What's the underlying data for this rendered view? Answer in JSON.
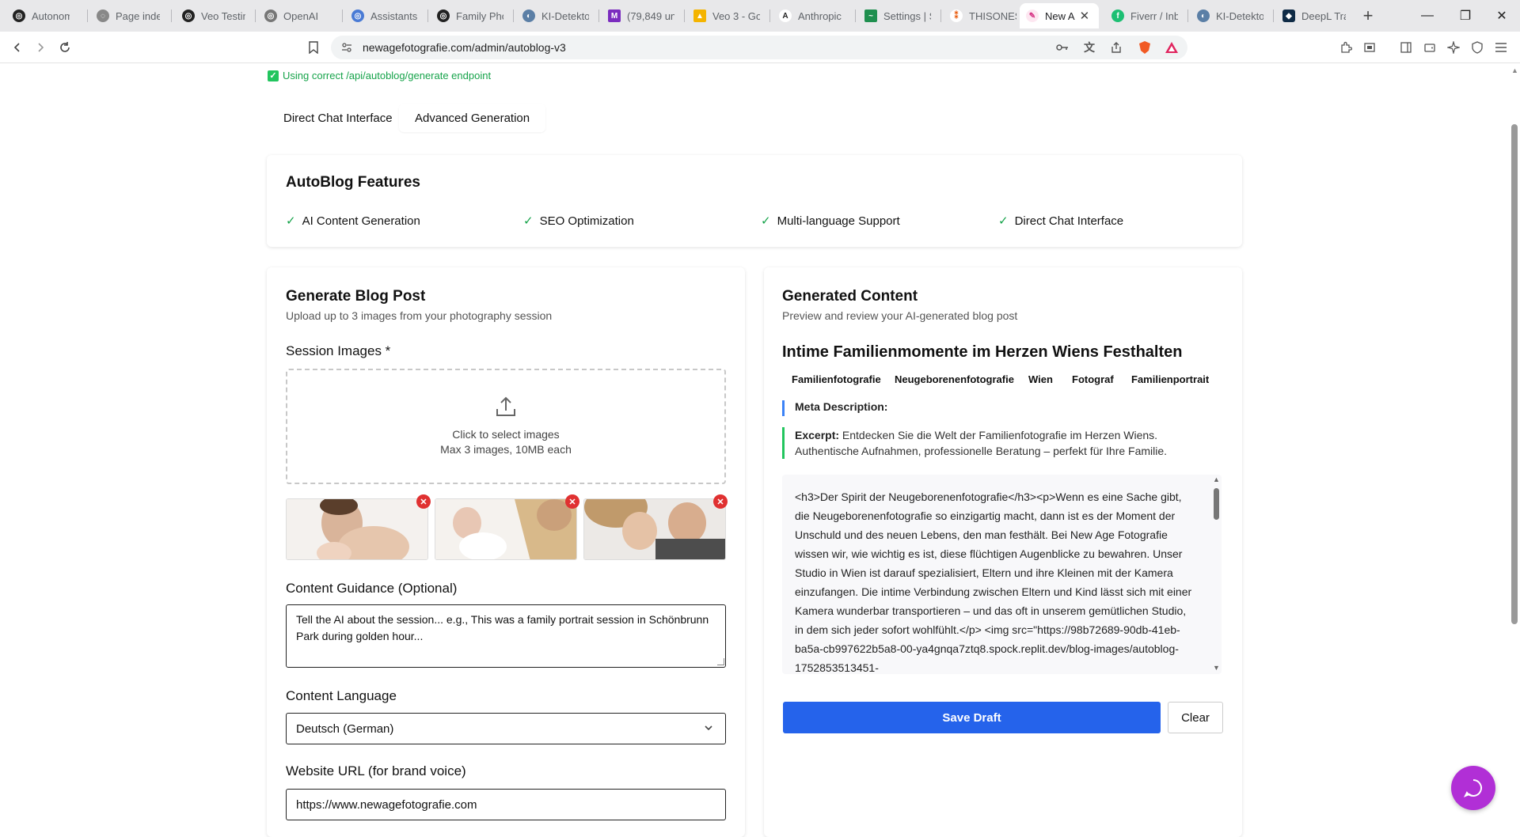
{
  "browser": {
    "tabs": [
      {
        "title": "Autonomo",
        "favicon": "openai-icon",
        "color": "#222222"
      },
      {
        "title": "Page index",
        "favicon": "page-index-icon",
        "color": "#666666"
      },
      {
        "title": "Veo Testim",
        "favicon": "openai-icon",
        "color": "#222222"
      },
      {
        "title": "OpenAI",
        "favicon": "openai-icon",
        "color": "#777777"
      },
      {
        "title": "Assistants",
        "favicon": "assistants-icon",
        "color": "#4a7bd5"
      },
      {
        "title": "Family Pho",
        "favicon": "openai-icon",
        "color": "#222222"
      },
      {
        "title": "KI-Detekto",
        "favicon": "ki-detektor-icon",
        "color": "#5b7fa6"
      },
      {
        "title": "(79,849 un",
        "favicon": "mail-icon",
        "color": "#7b2cbf"
      },
      {
        "title": "Veo 3 - Go",
        "favicon": "google-drive-icon",
        "color": "#f4b400"
      },
      {
        "title": "Anthropic",
        "favicon": "anthropic-icon",
        "color": "#222222"
      },
      {
        "title": "Settings | S",
        "favicon": "settings-app-icon",
        "color": "#1f8f4f"
      },
      {
        "title": "THISONES",
        "favicon": "thisones-icon",
        "color": "#e8590c"
      },
      {
        "title": "New A",
        "favicon": "new-tab-icon",
        "color": "#d63384",
        "active": true
      },
      {
        "title": "Fiverr / Inb",
        "favicon": "fiverr-icon",
        "color": "#1dbf73"
      },
      {
        "title": "KI-Detekto",
        "favicon": "ki-detektor-icon",
        "color": "#5b7fa6"
      },
      {
        "title": "DeepL Tra",
        "favicon": "deepl-icon",
        "color": "#0f2b46"
      }
    ],
    "url": "newagefotografie.com/admin/autoblog-v3"
  },
  "status": {
    "endpoint_text": "Using correct /api/autoblog/generate endpoint",
    "color": "#16a34a"
  },
  "tabs": {
    "direct_chat": "Direct Chat Interface",
    "advanced": "Advanced Generation"
  },
  "features": {
    "title": "AutoBlog Features",
    "items": [
      "AI Content Generation",
      "SEO Optimization",
      "Multi-language Support",
      "Direct Chat Interface"
    ]
  },
  "generate": {
    "title": "Generate Blog Post",
    "subtitle": "Upload up to 3 images from your photography session",
    "session_images_label": "Session Images *",
    "dropzone_primary": "Click to select images",
    "dropzone_secondary": "Max 3 images, 10MB each",
    "guidance_label": "Content Guidance (Optional)",
    "guidance_placeholder": "Tell the AI about the session... e.g., This was a family portrait session in Schönbrunn Park during golden hour...",
    "language_label": "Content Language",
    "language_value": "Deutsch (German)",
    "website_label": "Website URL (for brand voice)",
    "website_value": "https://www.newagefotografie.com"
  },
  "output": {
    "title": "Generated Content",
    "subtitle": "Preview and review your AI-generated blog post",
    "post_title": "Intime Familienmomente im Herzen Wiens Festhalten",
    "tags": [
      "Familienfotografie",
      "Neugeborenenfotografie",
      "Wien",
      "Fotograf",
      "Familienportrait"
    ],
    "meta_label": "Meta Description:",
    "excerpt_label": "Excerpt:",
    "excerpt_text": "Entdecken Sie die Welt der Familienfotografie im Herzen Wiens. Authentische Aufnahmen, professionelle Beratung – perfekt für Ihre Familie.",
    "html_content": "<h3>Der Spirit der Neugeborenenfotografie</h3><p>Wenn es eine Sache gibt, die Neugeborenenfotografie so einzigartig macht, dann ist es der Moment der Unschuld und des neuen Lebens, den man festhält. Bei New Age Fotografie wissen wir, wie wichtig es ist, diese flüchtigen Augenblicke zu bewahren. Unser Studio in Wien ist darauf spezialisiert, Eltern und ihre Kleinen mit der Kamera einzufangen. Die intime Verbindung zwischen Eltern und Kind lässt sich mit einer Kamera wunderbar transportieren – und das oft in unserem gemütlichen Studio, in dem sich jeder sofort wohlfühlt.</p> <img src=\"https://98b72689-90db-41eb-ba5a-cb997622b5a8-00-ya4gnqa7ztq8.spock.replit.dev/blog-images/autoblog-1752853513451-",
    "save_label": "Save Draft",
    "clear_label": "Clear"
  },
  "colors": {
    "primary": "#2563eb",
    "success": "#22c55e",
    "danger": "#e03131",
    "chat_fab": "#b12fd6"
  }
}
